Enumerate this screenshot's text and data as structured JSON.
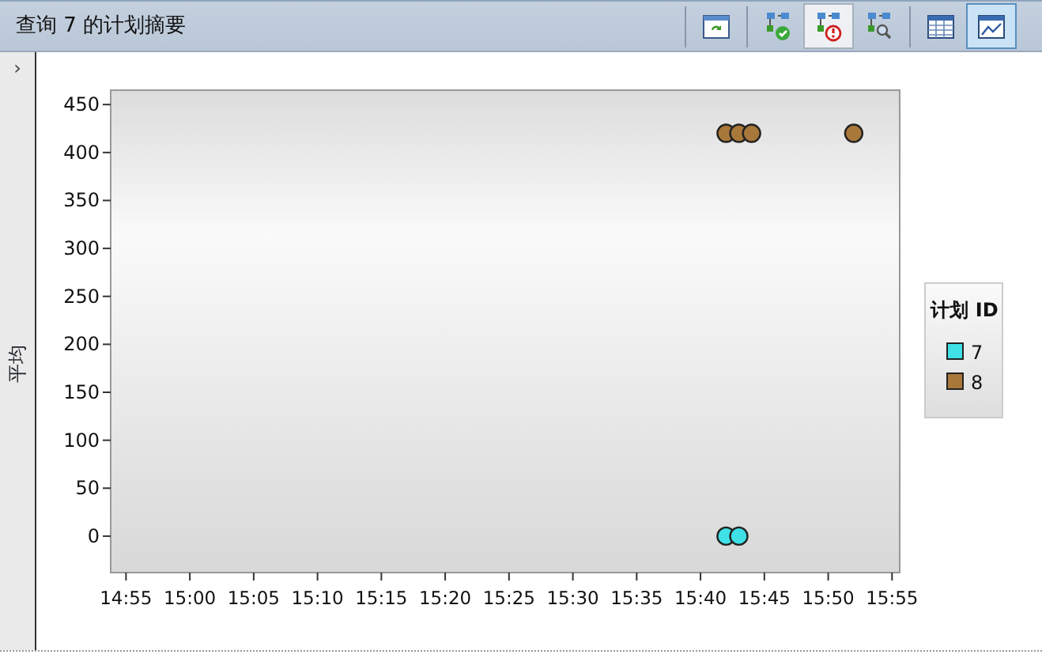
{
  "title": "查询 7 的计划摘要",
  "toolbar": [
    {
      "kind": "refresh",
      "on": false
    },
    {
      "kind": "plan-ok",
      "on": false
    },
    {
      "kind": "plan-alert",
      "on": true
    },
    {
      "kind": "plan-search",
      "on": false
    },
    {
      "kind": "table",
      "on": false
    },
    {
      "kind": "chart",
      "on": true
    }
  ],
  "sidebar": {
    "toggle": "›"
  },
  "chart": {
    "chart_data": {
      "type": "scatter",
      "ylabel": "平均",
      "legend_title": "计划 ID",
      "legend": "right",
      "ylim": [
        -38,
        465
      ],
      "categories": [
        "14:55",
        null,
        null,
        null,
        null,
        "15:00",
        null,
        null,
        null,
        null,
        "15:05",
        null,
        null,
        null,
        null,
        "15:10",
        null,
        null,
        null,
        null,
        "15:15",
        null,
        null,
        null,
        null,
        "15:20",
        null,
        null,
        null,
        null,
        "15:25",
        null,
        null,
        null,
        null,
        "15:30",
        null,
        null,
        null,
        null,
        "15:35",
        null,
        null,
        null,
        null,
        "15:40",
        null,
        null,
        null,
        null,
        "15:45",
        null,
        null,
        null,
        null,
        "15:50",
        null,
        null,
        null,
        null,
        "15:55"
      ],
      "yticks": [
        0,
        50,
        100,
        150,
        200,
        250,
        300,
        350,
        400,
        450
      ],
      "series": [
        {
          "name": "7",
          "color": "#3fe0e6",
          "values": [
            null,
            null,
            null,
            null,
            null,
            null,
            null,
            null,
            null,
            null,
            null,
            null,
            null,
            null,
            null,
            null,
            null,
            null,
            null,
            null,
            null,
            null,
            null,
            null,
            null,
            null,
            null,
            null,
            null,
            null,
            null,
            null,
            null,
            null,
            null,
            null,
            null,
            null,
            null,
            null,
            null,
            null,
            null,
            null,
            null,
            null,
            null,
            0,
            0,
            null,
            null,
            null,
            null,
            null,
            null,
            null,
            null,
            null,
            null,
            null,
            null
          ]
        },
        {
          "name": "8",
          "color": "#a8773a",
          "values": [
            null,
            null,
            null,
            null,
            null,
            null,
            null,
            null,
            null,
            null,
            null,
            null,
            null,
            null,
            null,
            null,
            null,
            null,
            null,
            null,
            null,
            null,
            null,
            null,
            null,
            null,
            null,
            null,
            null,
            null,
            null,
            null,
            null,
            null,
            null,
            null,
            null,
            null,
            null,
            null,
            null,
            null,
            null,
            null,
            null,
            null,
            null,
            420,
            420,
            420,
            null,
            null,
            null,
            null,
            null,
            null,
            null,
            420,
            null,
            null,
            null
          ]
        }
      ]
    }
  }
}
